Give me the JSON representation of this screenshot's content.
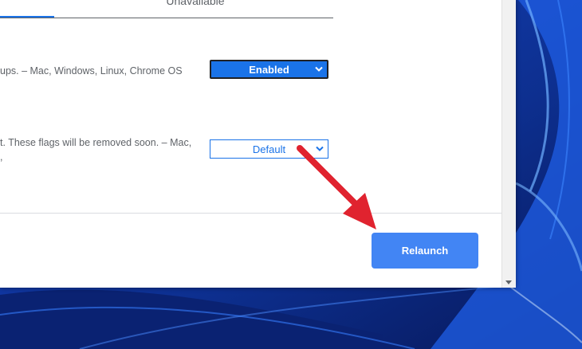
{
  "tabs": {
    "unavailable_label": "Unavailable"
  },
  "flags": [
    {
      "description": "ups. – Mac, Windows, Linux, Chrome OS",
      "selected": "Enabled"
    },
    {
      "description_line1": "t. These flags will be removed soon. – Mac,",
      "description_line2": ",",
      "selected": "Default"
    }
  ],
  "footer": {
    "relaunch_label": "Relaunch"
  },
  "colors": {
    "accent": "#1a73e8",
    "relaunch": "#4285f4",
    "annotation_arrow": "#e0232f"
  },
  "icons": {
    "select_chevron": "chevron-down-icon",
    "scroll_down": "scroll-down-arrow-icon",
    "annotation": "red-arrow-icon"
  }
}
